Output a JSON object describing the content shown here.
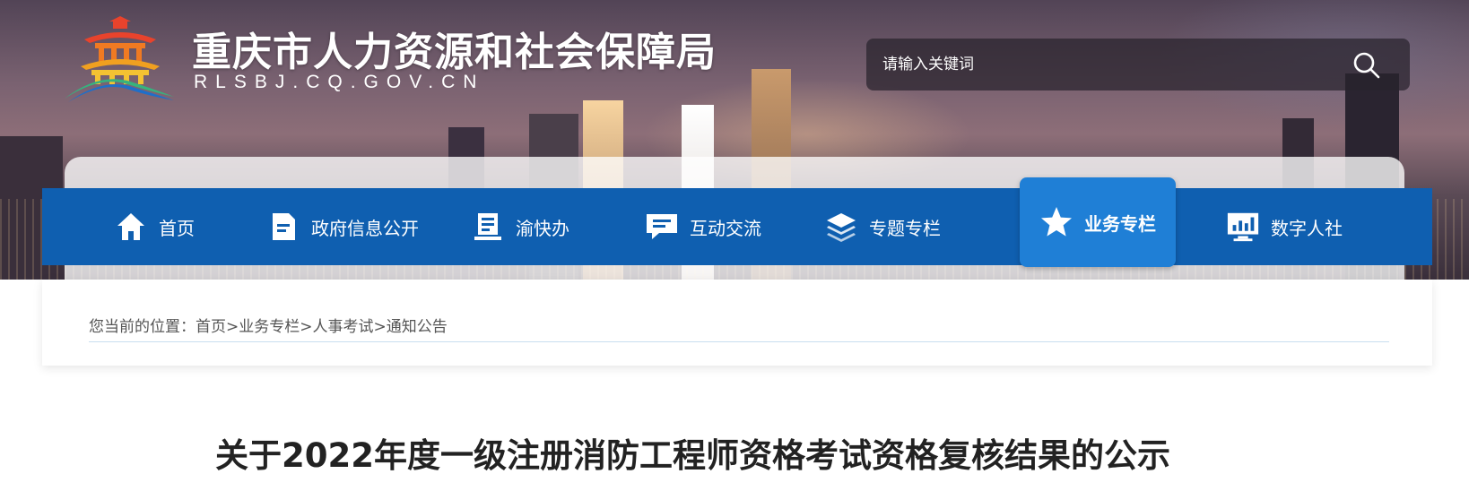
{
  "header": {
    "site_title": "重庆市人力资源和社会保障局",
    "site_domain": "RLSBJ.CQ.GOV.CN",
    "logo_icon": "temple-logo-icon"
  },
  "search": {
    "placeholder": "请输入关键词",
    "icon": "search-icon"
  },
  "nav": {
    "active_color": "#1f7fd6",
    "bar_color": "#0f5fb0",
    "items": [
      {
        "label": "首页",
        "icon": "home-icon",
        "active": false
      },
      {
        "label": "政府信息公开",
        "icon": "document-icon",
        "active": false
      },
      {
        "label": "渝快办",
        "icon": "list-document-icon",
        "active": false
      },
      {
        "label": "互动交流",
        "icon": "chat-icon",
        "active": false
      },
      {
        "label": "专题专栏",
        "icon": "layers-icon",
        "active": false
      },
      {
        "label": "业务专栏",
        "icon": "star-icon",
        "active": true
      },
      {
        "label": "数字人社",
        "icon": "monitor-chart-icon",
        "active": false
      }
    ]
  },
  "breadcrumb": {
    "prefix": "您当前的位置：",
    "items": [
      "首页",
      "业务专栏",
      "人事考试",
      "通知公告"
    ],
    "separator": ">"
  },
  "article": {
    "title": "关于2022年度一级注册消防工程师资格考试资格复核结果的公示"
  }
}
